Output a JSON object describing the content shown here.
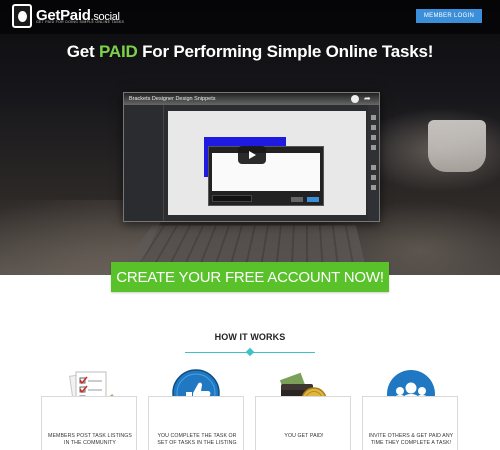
{
  "header": {
    "brand": "GetPaid",
    "brand_domain": ".social",
    "tagline": "GET PAID FOR DOING SIMPLE ONLINE TASKS",
    "member_login_label": "MEMBER LOGIN"
  },
  "hero": {
    "headline_pre": "Get ",
    "headline_accent": "PAID",
    "headline_post": " For Performing Simple Online Tasks!",
    "video": {
      "title": "Brackets Designer Design Snippets",
      "play_icon": "play-icon"
    },
    "cta_label": "CREATE YOUR FREE ACCOUNT NOW!"
  },
  "how_it_works": {
    "title": "HOW IT WORKS",
    "steps": [
      {
        "caption": "MEMBERS POST TASK LISTINGS IN THE COMMUNITY",
        "icon": "checklist-icon"
      },
      {
        "caption": "YOU COMPLETE THE TASK OR SET OF TASKS IN THE LISTING",
        "icon": "thumbs-up-icon"
      },
      {
        "caption": "YOU GET PAID!",
        "icon": "wallet-coin-icon"
      },
      {
        "caption": "INVITE OTHERS & GET PAID ANY TIME THEY COMPLETE A TASK!",
        "icon": "people-group-icon"
      }
    ]
  },
  "colors": {
    "accent_green": "#7dd14a",
    "cta_green": "#59c22a",
    "login_blue": "#3b8fd8",
    "teal_divider": "#3fc1c9",
    "icon_blue": "#1f78c1"
  }
}
